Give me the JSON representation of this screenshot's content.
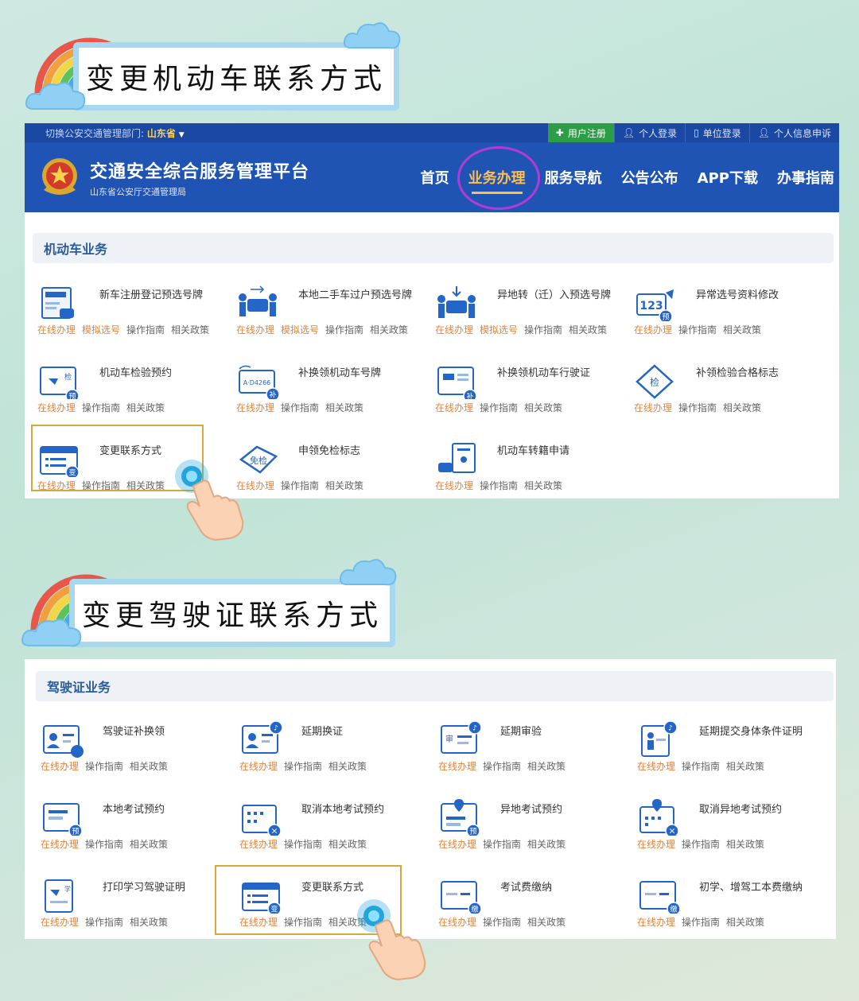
{
  "banner1": {
    "title": "变更机动车联系方式"
  },
  "banner2": {
    "title": "变更驾驶证联系方式"
  },
  "topbar": {
    "dept_label": "切换公安交通管理部门:",
    "dept_value": "山东省",
    "register": "用户注册",
    "personal_login": "个人登录",
    "unit_login": "单位登录",
    "appeal": "个人信息申诉"
  },
  "brand": {
    "title": "交通安全综合服务管理平台",
    "subtitle": "山东省公安厅交通管理局"
  },
  "nav": [
    "首页",
    "业务办理",
    "服务导航",
    "公告公布",
    "APP下载",
    "办事指南"
  ],
  "labels": {
    "online": "在线办理",
    "mock": "模拟选号",
    "guide": "操作指南",
    "policy": "相关政策"
  },
  "vehicle": {
    "title": "机动车业务",
    "items": [
      {
        "name": "新车注册登记预选号牌",
        "mock": true
      },
      {
        "name": "本地二手车过户预选号牌",
        "mock": true
      },
      {
        "name": "异地转（迁）入预选号牌",
        "mock": true
      },
      {
        "name": "异常选号资料修改",
        "mock": false
      },
      {
        "name": "机动车检验预约",
        "mock": false
      },
      {
        "name": "补换领机动车号牌",
        "mock": false
      },
      {
        "name": "补换领机动车行驶证",
        "mock": false
      },
      {
        "name": "补领检验合格标志",
        "mock": false
      },
      {
        "name": "变更联系方式",
        "mock": false
      },
      {
        "name": "申领免检标志",
        "mock": false
      },
      {
        "name": "机动车转籍申请",
        "mock": false
      }
    ]
  },
  "license": {
    "title": "驾驶证业务",
    "items": [
      {
        "name": "驾驶证补换领"
      },
      {
        "name": "延期换证"
      },
      {
        "name": "延期审验"
      },
      {
        "name": "延期提交身体条件证明"
      },
      {
        "name": "本地考试预约"
      },
      {
        "name": "取消本地考试预约"
      },
      {
        "name": "异地考试预约"
      },
      {
        "name": "取消异地考试预约"
      },
      {
        "name": "打印学习驾驶证明"
      },
      {
        "name": "变更联系方式"
      },
      {
        "name": "考试费缴纳"
      },
      {
        "name": "初学、增驾工本费缴纳"
      }
    ]
  },
  "icon_badges": {
    "plate_tag": "A·D4266",
    "plate_123": "123",
    "inspect": "检",
    "exempt": "免检",
    "reserve": "预",
    "replace": "补",
    "change": "变",
    "cancel": "×",
    "pay": "缴",
    "study": "学",
    "audit": "审"
  },
  "colors": {
    "header": "#1f54b5",
    "accent": "#ffbf4a",
    "online": "#e8833a",
    "highlight": "#d6a93a"
  }
}
